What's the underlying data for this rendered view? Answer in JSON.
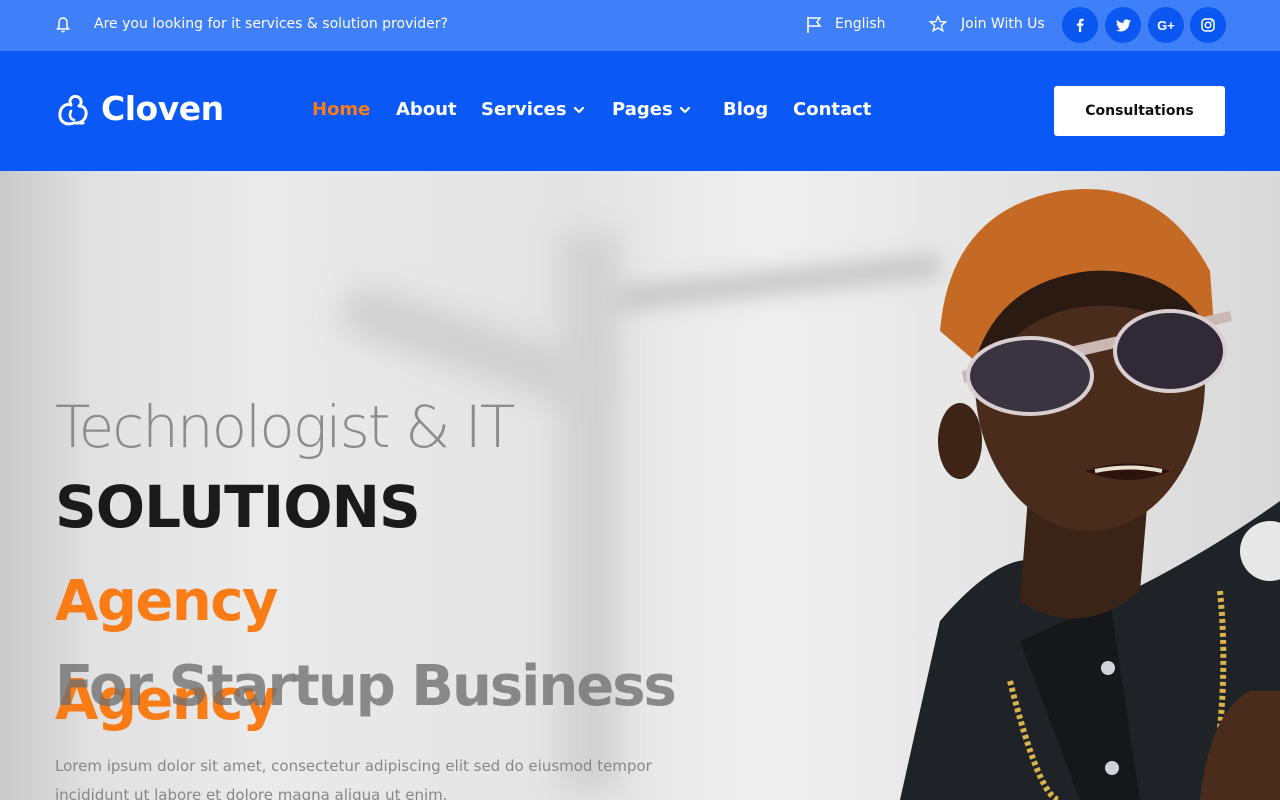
{
  "topbar": {
    "notice": "Are you looking for it services & solution provider?",
    "language": "English",
    "join": "Join With Us",
    "social": [
      {
        "icon": "facebook-icon",
        "glyph": "f"
      },
      {
        "icon": "twitter-icon",
        "glyph": "t"
      },
      {
        "icon": "google-plus-icon",
        "glyph": "G+"
      },
      {
        "icon": "instagram-icon",
        "glyph": "ig"
      }
    ]
  },
  "header": {
    "brand": "Cloven",
    "nav": [
      {
        "label": "Home",
        "active": true
      },
      {
        "label": "About"
      },
      {
        "label": "Services",
        "dropdown": true
      },
      {
        "label": "Pages",
        "dropdown": true
      },
      {
        "label": "Blog"
      },
      {
        "label": "Contact"
      }
    ],
    "cta": "Consultations"
  },
  "hero": {
    "line1": "Technologist & IT",
    "line2": "SOLUTIONS",
    "agency": "Agency",
    "line4": "For Startup Business",
    "description": "Lorem ipsum dolor sit amet, consectetur adipiscing elit sed do eiusmod tempor incididunt ut labore et dolore magna aliqua ut enim."
  },
  "colors": {
    "topbar": "#3f7ff7",
    "header": "#0a58f5",
    "accent": "#f97c16",
    "social_bg": "#0b57f2"
  }
}
